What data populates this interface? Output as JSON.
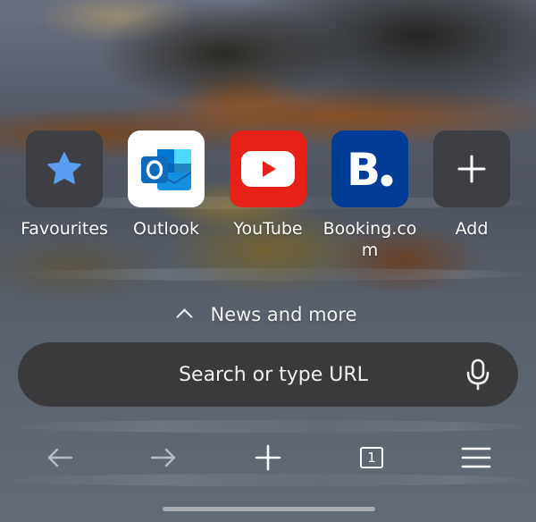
{
  "shortcuts": [
    {
      "label": "Favourites",
      "icon": "star-icon",
      "bg": "#3d3f44",
      "fg": "#5b9df0"
    },
    {
      "label": "Outlook",
      "icon": "outlook-logo-icon",
      "bg": "#ffffff",
      "fg": "#0f6cbd"
    },
    {
      "label": "YouTube",
      "icon": "youtube-logo-icon",
      "bg": "#e62117",
      "fg": "#ffffff"
    },
    {
      "label": "Booking.com",
      "icon": "booking-logo-icon",
      "bg": "#003b95",
      "fg": "#ffffff"
    },
    {
      "label": "Add",
      "icon": "plus-icon",
      "bg": "#3d3f44",
      "fg": "#ffffff"
    }
  ],
  "news": {
    "label": "News and more"
  },
  "search": {
    "placeholder": "Search or type URL"
  },
  "toolbar": {
    "back": "back-arrow-icon",
    "forward": "forward-arrow-icon",
    "new_tab": "plus-icon",
    "tabs_count": "1",
    "menu": "hamburger-menu-icon"
  }
}
